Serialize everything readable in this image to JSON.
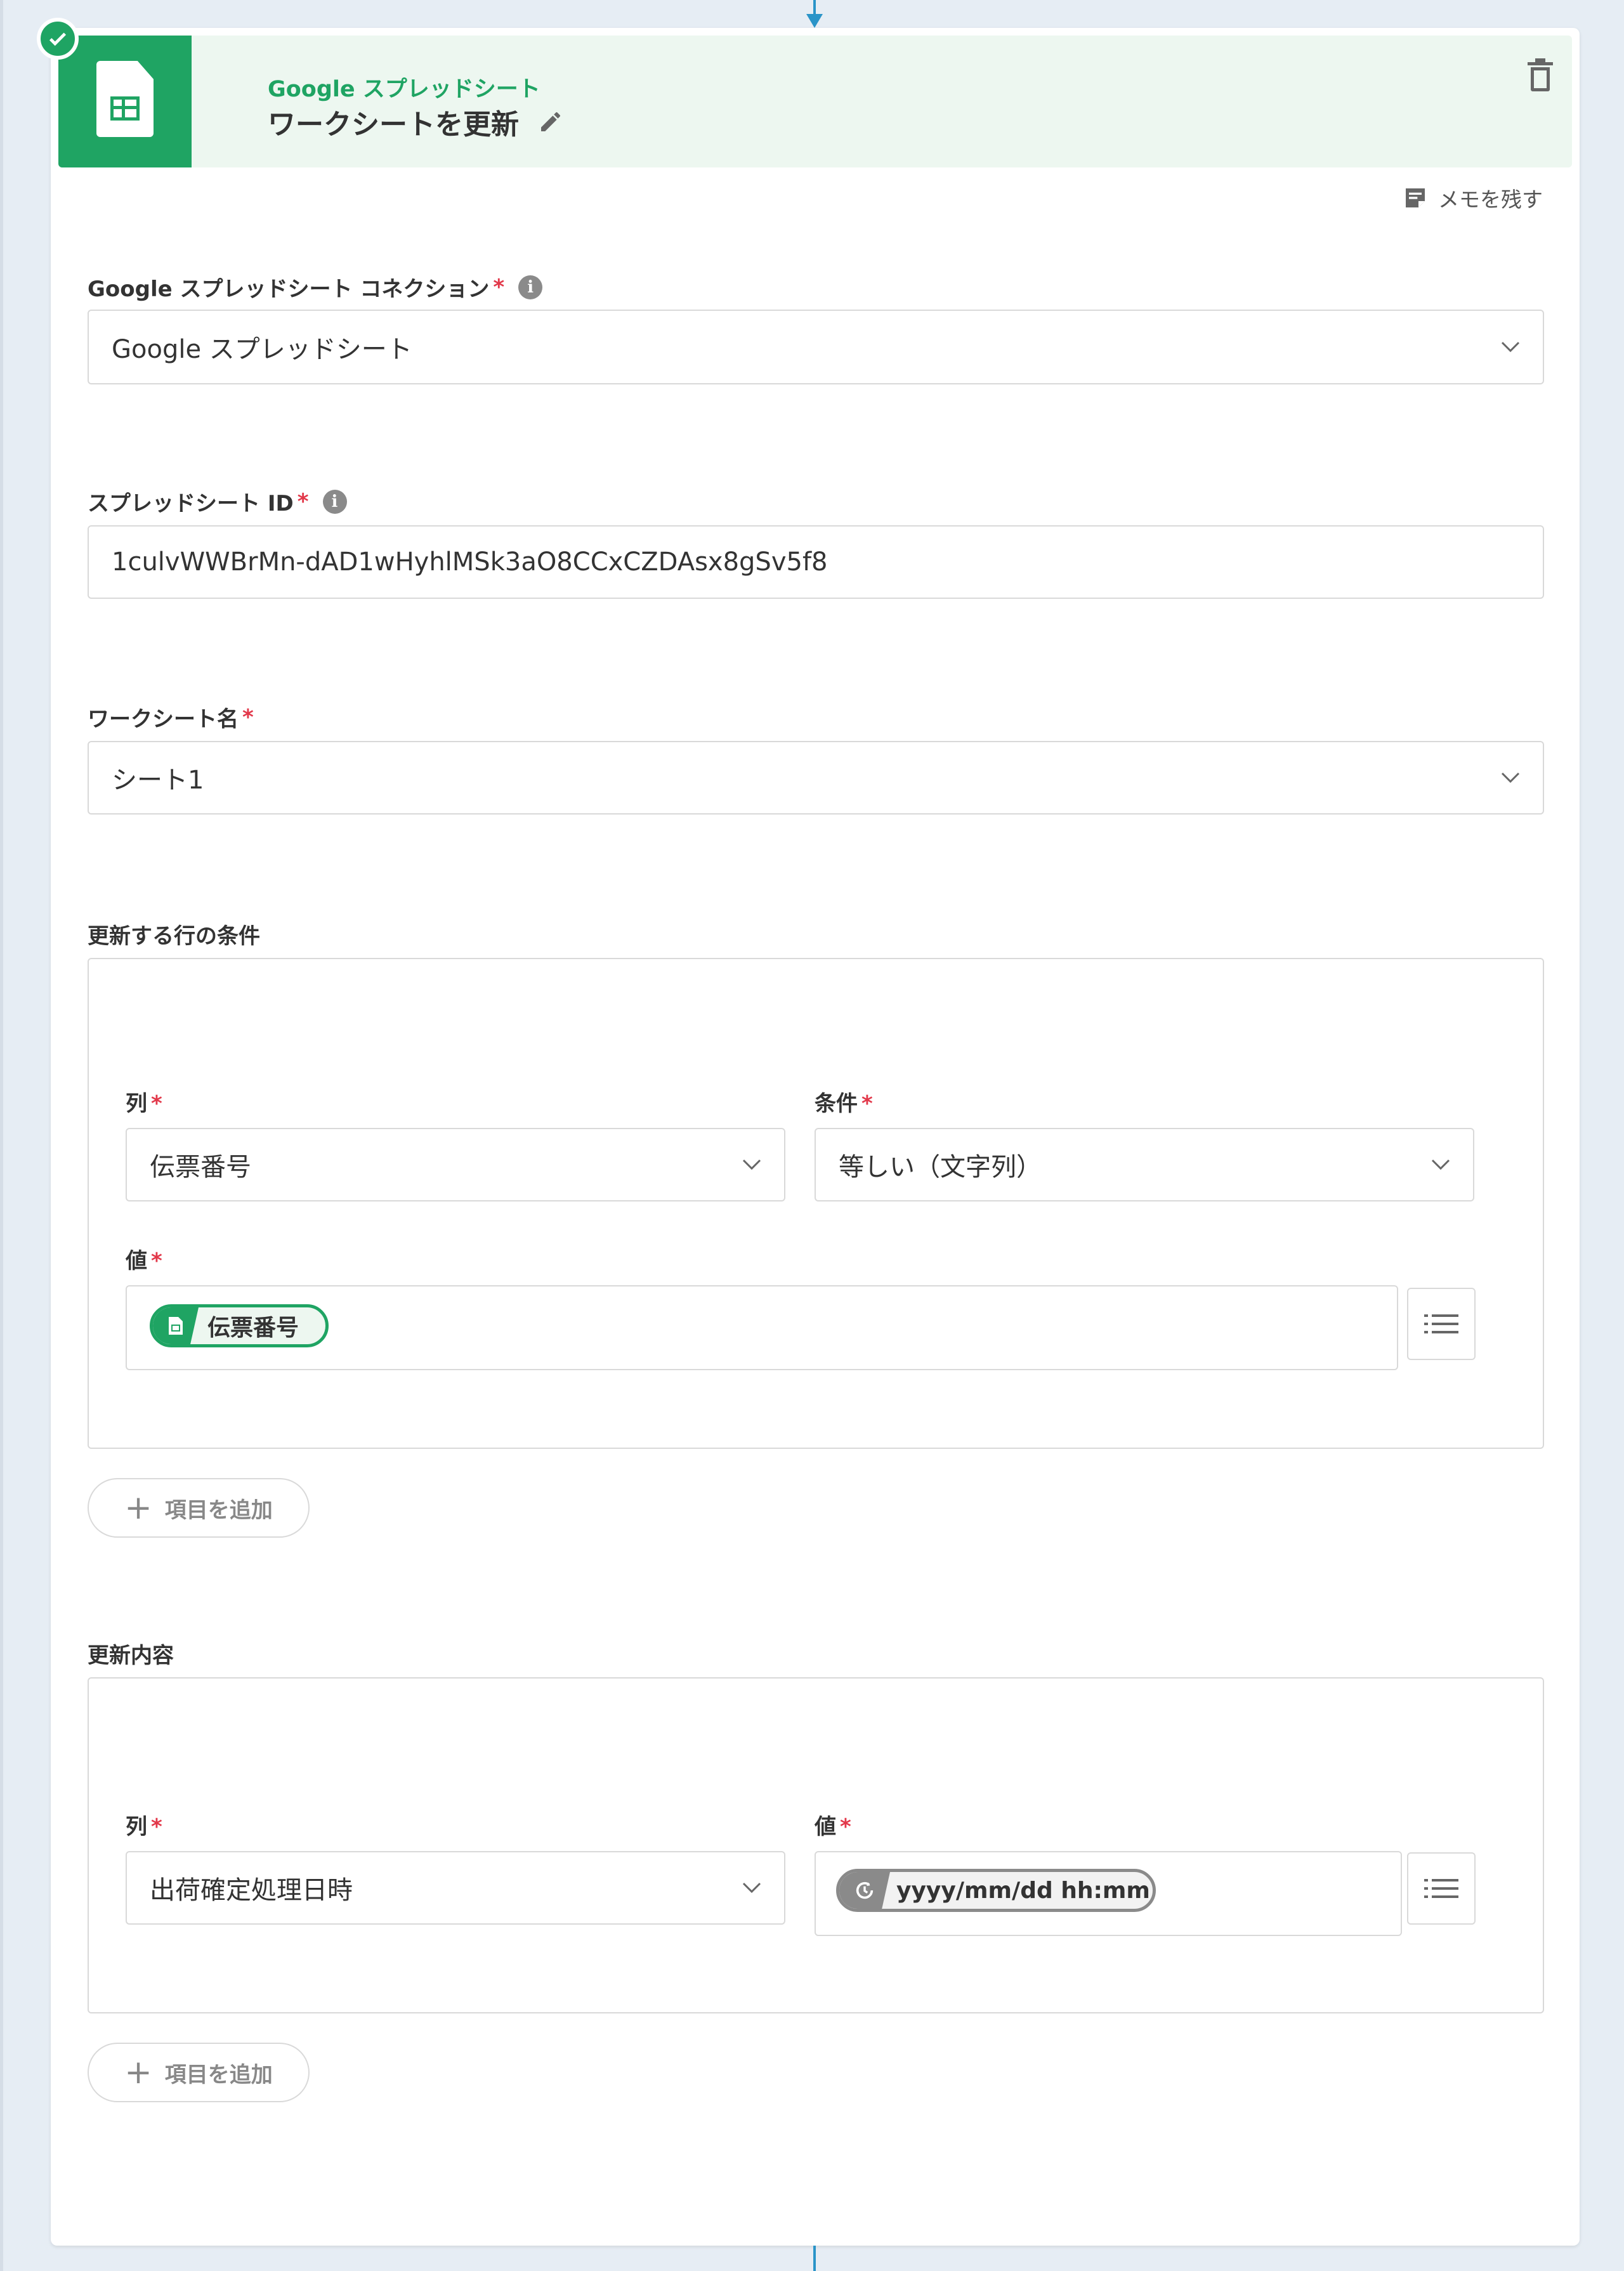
{
  "header": {
    "app_name": "Google スプレッドシート",
    "action_title": "ワークシートを更新",
    "memo_label": "メモを残す"
  },
  "connection": {
    "label": "Google スプレッドシート コネクション",
    "required_mark": "*",
    "value": "Google スプレッドシート"
  },
  "spreadsheet_id": {
    "label": "スプレッドシート ID",
    "required_mark": "*",
    "value": "1culvWWBrMn-dAD1wHyhlMSk3aO8CCxCZDAsx8gSv5f8"
  },
  "worksheet": {
    "label": "ワークシート名",
    "required_mark": "*",
    "value": "シート1"
  },
  "row_condition": {
    "section_label": "更新する行の条件",
    "column_label": "列",
    "column_value": "伝票番号",
    "condition_label": "条件",
    "condition_value": "等しい（文字列）",
    "value_label": "値",
    "value_pill": "伝票番号",
    "required_mark": "*",
    "add_label": "項目を追加"
  },
  "update_content": {
    "section_label": "更新内容",
    "column_label": "列",
    "column_value": "出荷確定処理日時",
    "value_label": "値",
    "value_pill": "yyyy/mm/dd hh:mm",
    "required_mark": "*",
    "add_label": "項目を追加"
  },
  "colors": {
    "brand_green": "#1fa463",
    "connector_blue": "#2a94c8",
    "required_red": "#e2384a"
  },
  "icons": [
    "check-icon",
    "spreadsheet-icon",
    "pencil-icon",
    "trash-icon",
    "memo-icon",
    "info-icon",
    "chevron-down-icon",
    "list-icon",
    "clock-icon",
    "plus-icon"
  ]
}
